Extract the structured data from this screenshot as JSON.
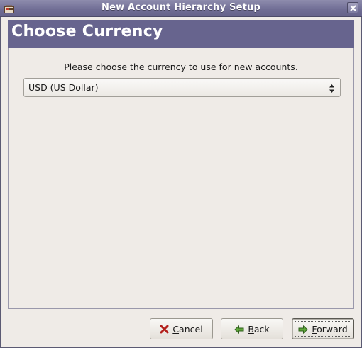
{
  "window": {
    "title": "New Account Hierarchy Setup",
    "app_icon": "gnucash-app-icon",
    "close_icon": "close-icon"
  },
  "header": {
    "title": "Choose Currency",
    "background_color": "#67648e"
  },
  "content": {
    "prompt": "Please choose the currency to use for new accounts.",
    "currency_select": {
      "selected": "USD (US Dollar)",
      "icon": "updown-arrows-icon"
    }
  },
  "buttons": {
    "cancel": {
      "prefix": "",
      "accel": "C",
      "rest": "ancel",
      "icon": "red-x-icon"
    },
    "back": {
      "prefix": "",
      "accel": "B",
      "rest": "ack",
      "icon": "green-left-arrow-icon"
    },
    "forward": {
      "prefix": "",
      "accel": "F",
      "rest": "orward",
      "icon": "green-right-arrow-icon"
    }
  }
}
